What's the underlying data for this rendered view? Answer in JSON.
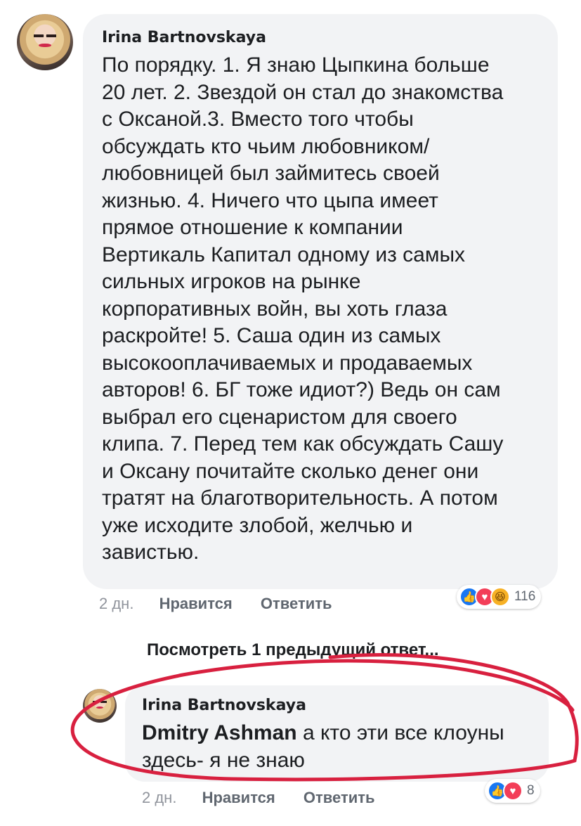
{
  "comment": {
    "author": "Irina Bartnovskaya",
    "lines": [
      "По порядку. 1. Я знаю Цыпкина больше",
      "20 лет. 2. Звездой он стал до знакомства",
      "с Оксаной.3. Вместо того чтобы",
      "обсуждать кто чьим любовником/",
      "любовницей был займитесь своей",
      "жизнью. 4. Ничего что цыпа имеет",
      "прямое отношение к компании",
      "Вертикаль Капитал одному из самых",
      "сильных игроков на рынке",
      "корпоративных войн, вы хоть глаза",
      "раскройте! 5. Саша один из самых",
      "высокооплачиваемых и продаваемых",
      "авторов! 6. БГ тоже идиот?) Ведь он сам",
      "выбрал его сценаристом для своего",
      "клипа. 7.  Перед тем как обсуждать Сашу",
      "и Оксану почитайте сколько денег они",
      "тратят на благотворительность. А потом",
      "уже исходите злобой, желчью и",
      "завистью."
    ],
    "time": "2 дн.",
    "like_label": "Нравится",
    "reply_label": "Ответить",
    "reactions": {
      "icons": [
        "like-icon",
        "love-icon",
        "haha-icon"
      ],
      "count": "116"
    }
  },
  "view_more": "Посмотреть 1 предыдущий ответ...",
  "reply": {
    "author": "Irina Bartnovskaya",
    "mention": "Dmitry Ashman",
    "text_line1": " а кто эти все клоуны",
    "text_line2": "здесь- я не знаю",
    "time": "2 дн.",
    "like_label": "Нравится",
    "reply_label": "Ответить",
    "reactions": {
      "icons": [
        "like-icon",
        "love-icon"
      ],
      "count": "8"
    }
  },
  "annotation_color": "#d8203f"
}
